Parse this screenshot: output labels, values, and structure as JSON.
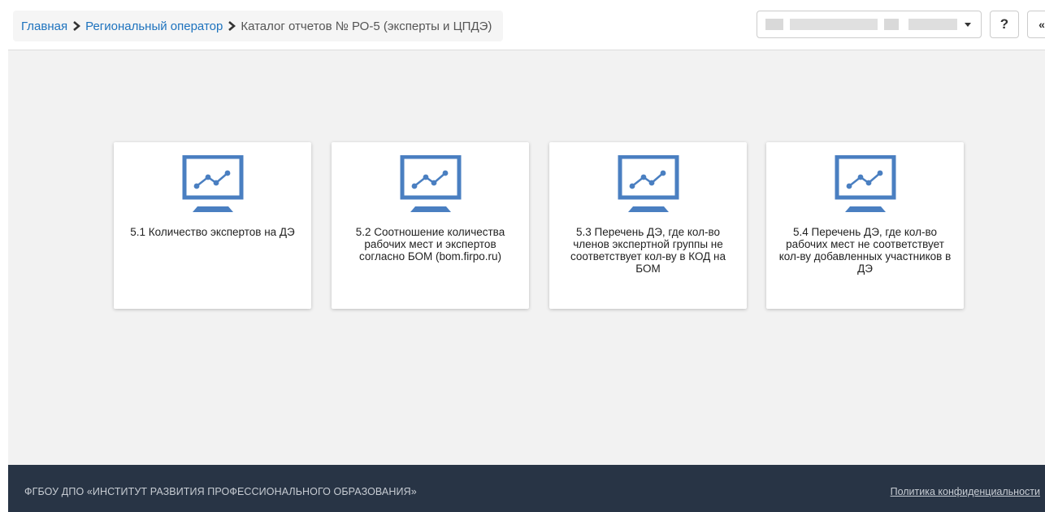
{
  "breadcrumb": {
    "items": [
      {
        "label": "Главная"
      },
      {
        "label": "Региональный оператор"
      }
    ],
    "current": "Каталог отчетов № РО-5 (эксперты и ЦПДЭ)"
  },
  "header": {
    "select_value": "",
    "help_label": "?",
    "collapse_label": "«"
  },
  "cards": [
    {
      "title": "5.1 Количество экспертов на ДЭ",
      "icon": "monitor-chart-icon"
    },
    {
      "title": "5.2 Соотношение количества рабочих мест и экспертов согласно БОМ (bom.firpo.ru)",
      "icon": "monitor-chart-icon"
    },
    {
      "title": "5.3 Перечень ДЭ, где кол-во членов экспертной группы не соответствует кол-ву в КОД на БОМ",
      "icon": "monitor-chart-icon"
    },
    {
      "title": "5.4 Перечень ДЭ, где кол-во рабочих мест не соответствует кол-ву добавленных участников в ДЭ",
      "icon": "monitor-chart-icon"
    }
  ],
  "footer": {
    "org": "ФГБОУ ДПО «ИНСТИТУТ РАЗВИТИЯ ПРОФЕССИОНАЛЬНОГО ОБРАЗОВАНИЯ»",
    "privacy_link": "Политика конфиденциальности"
  },
  "colors": {
    "link": "#1e73be",
    "icon": "#4a7fc1",
    "footer_bg": "#283445"
  }
}
